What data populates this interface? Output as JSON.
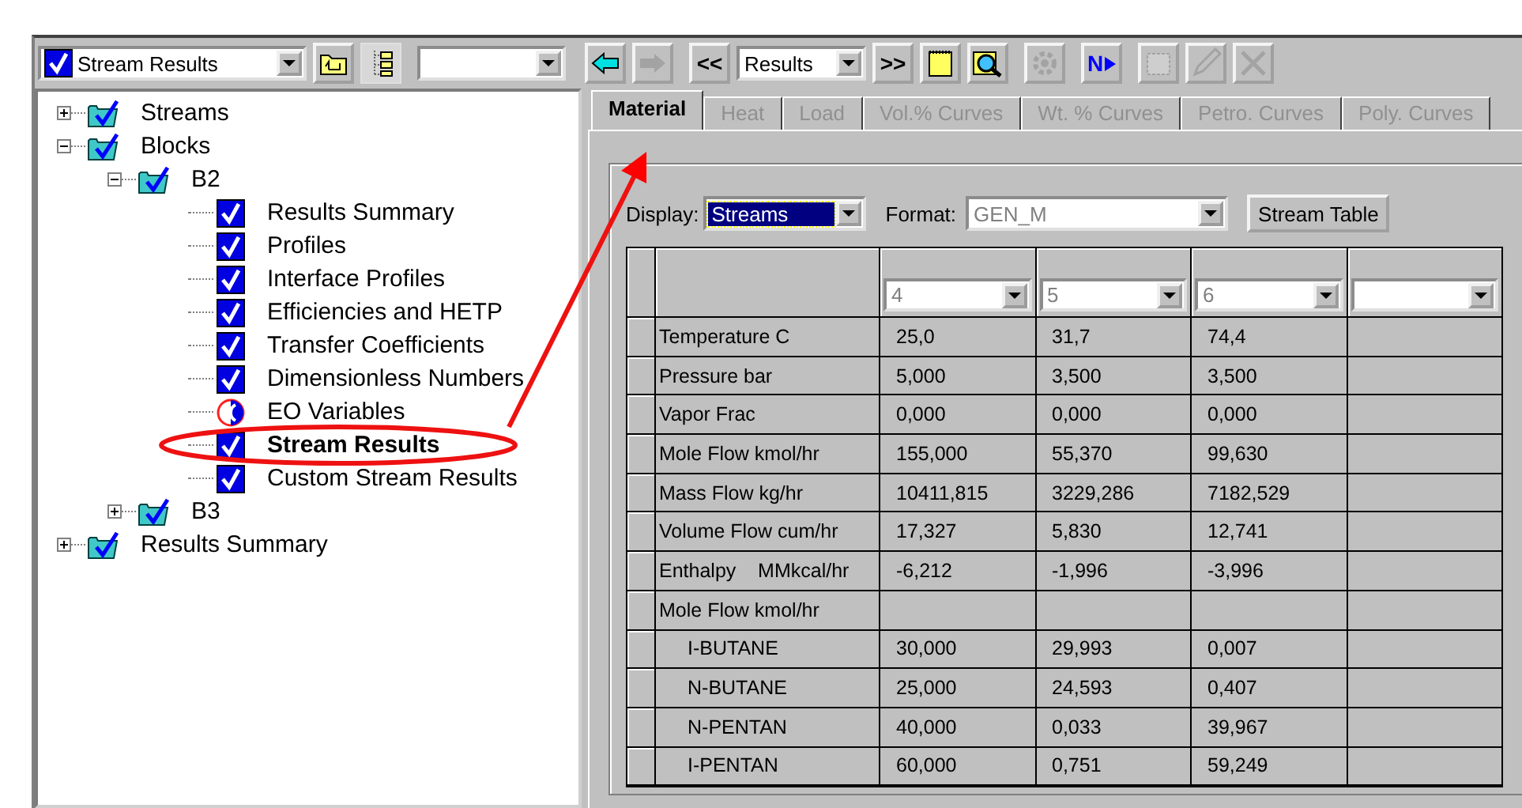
{
  "toolbar": {
    "view_combo": {
      "value": "Stream Results",
      "checked": true
    },
    "sheet_combo": {
      "value": "Results"
    },
    "buttons": [
      {
        "kind": "folder_up",
        "disabled": false,
        "pressed": false
      },
      {
        "kind": "tree",
        "disabled": false,
        "pressed": true
      },
      {
        "kind": "blank_combo"
      },
      {
        "kind": "back",
        "disabled": false,
        "pressed": false
      },
      {
        "kind": "forward",
        "disabled": true,
        "pressed": false
      },
      {
        "kind": "first",
        "label": "<<",
        "disabled": false,
        "pressed": false
      },
      {
        "kind": "sheet_combo"
      },
      {
        "kind": "last",
        "label": ">>",
        "disabled": false,
        "pressed": false
      },
      {
        "kind": "notes",
        "disabled": false,
        "pressed": false
      },
      {
        "kind": "inspect",
        "disabled": false,
        "pressed": false
      },
      {
        "kind": "gear",
        "disabled": true,
        "pressed": false
      },
      {
        "kind": "next",
        "label": "N",
        "disabled": false,
        "pressed": false
      },
      {
        "kind": "frame",
        "disabled": true,
        "pressed": false
      },
      {
        "kind": "pencil",
        "disabled": true,
        "pressed": false
      },
      {
        "kind": "delete",
        "disabled": true,
        "pressed": false
      }
    ]
  },
  "tree": [
    {
      "label": "Streams",
      "kind": "folder",
      "expanded": false,
      "selected": false
    },
    {
      "label": "Blocks",
      "kind": "folder",
      "expanded": true,
      "selected": false,
      "children": [
        {
          "label": "B2",
          "kind": "folder",
          "expanded": true,
          "selected": false,
          "children": [
            {
              "label": "Results Summary",
              "kind": "form",
              "selected": false
            },
            {
              "label": "Profiles",
              "kind": "form",
              "selected": false
            },
            {
              "label": "Interface Profiles",
              "kind": "form",
              "selected": false
            },
            {
              "label": "Efficiencies and HETP",
              "kind": "form",
              "selected": false
            },
            {
              "label": "Transfer Coefficients",
              "kind": "form",
              "selected": false
            },
            {
              "label": "Dimensionless Numbers",
              "kind": "form",
              "selected": false
            },
            {
              "label": "EO Variables",
              "kind": "eo",
              "selected": false
            },
            {
              "label": "Stream Results",
              "kind": "form",
              "selected": true
            },
            {
              "label": "Custom Stream Results",
              "kind": "form",
              "selected": false
            }
          ]
        },
        {
          "label": "B3",
          "kind": "folder",
          "expanded": false,
          "selected": false
        }
      ]
    },
    {
      "label": "Results Summary",
      "kind": "folder",
      "expanded": false,
      "selected": false
    }
  ],
  "tabs": [
    {
      "label": "Material",
      "selected": true,
      "disabled": false
    },
    {
      "label": "Heat",
      "selected": false,
      "disabled": true
    },
    {
      "label": "Load",
      "selected": false,
      "disabled": true
    },
    {
      "label": "Vol.% Curves",
      "selected": false,
      "disabled": true
    },
    {
      "label": "Wt. % Curves",
      "selected": false,
      "disabled": true
    },
    {
      "label": "Petro. Curves",
      "selected": false,
      "disabled": true
    },
    {
      "label": "Poly. Curves",
      "selected": false,
      "disabled": true
    }
  ],
  "display": {
    "label": "Display:",
    "value": "Streams"
  },
  "format": {
    "label": "Format:",
    "value": "GEN_M",
    "disabled": true
  },
  "stream_table_button": "Stream Table",
  "table": {
    "columns": [
      {
        "value": "4"
      },
      {
        "value": "5"
      },
      {
        "value": "6"
      },
      {}
    ],
    "rows": [
      {
        "label": "Temperature C",
        "values": [
          "25,0",
          "31,7",
          "74,4"
        ]
      },
      {
        "label": "Pressure bar",
        "values": [
          "5,000",
          "3,500",
          "3,500"
        ]
      },
      {
        "label": "Vapor Frac",
        "values": [
          "0,000",
          "0,000",
          "0,000"
        ]
      },
      {
        "label": "Mole Flow kmol/hr",
        "values": [
          "155,000",
          "55,370",
          "99,630"
        ]
      },
      {
        "label": "Mass Flow kg/hr",
        "values": [
          "10411,815",
          "3229,286",
          "7182,529"
        ]
      },
      {
        "label": "Volume Flow cum/hr",
        "values": [
          "17,327",
          "5,830",
          "12,741"
        ]
      },
      {
        "label": "Enthalpy    MMkcal/hr",
        "values": [
          "-6,212",
          "-1,996",
          "-3,996"
        ]
      },
      {
        "label": "Mole Flow kmol/hr",
        "children": [
          {
            "label": "I-BUTANE",
            "values": [
              "30,000",
              "29,993",
              "0,007"
            ]
          },
          {
            "label": "N-BUTANE",
            "values": [
              "25,000",
              "24,593",
              "0,407"
            ]
          },
          {
            "label": "N-PENTAN",
            "values": [
              "40,000",
              "0,033",
              "39,967"
            ]
          },
          {
            "label": "I-PENTAN",
            "values": [
              "60,000",
              "0,751",
              "59,249"
            ]
          }
        ]
      }
    ]
  }
}
